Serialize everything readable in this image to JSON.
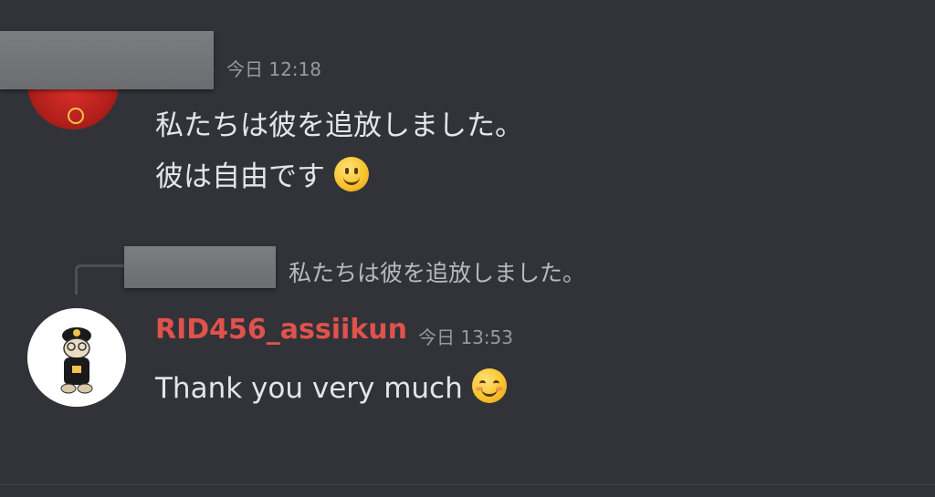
{
  "colors": {
    "background": "#313338",
    "username": "#e0524c",
    "timestamp": "#949ba4",
    "message_text": "#e3e5e8",
    "reply_text": "#b5bac1"
  },
  "message1": {
    "timestamp": "今日 12:18",
    "lines": [
      "私たちは彼を追放しました。",
      "彼は自由です"
    ],
    "emoji": "slightly-smiling-face-icon"
  },
  "reply": {
    "text": "私たちは彼を追放しました。"
  },
  "message2": {
    "username": "RID456_assiikun",
    "timestamp": "今日 13:53",
    "text": "Thank you very much",
    "emoji": "smiling-face-with-smiling-eyes-icon"
  }
}
